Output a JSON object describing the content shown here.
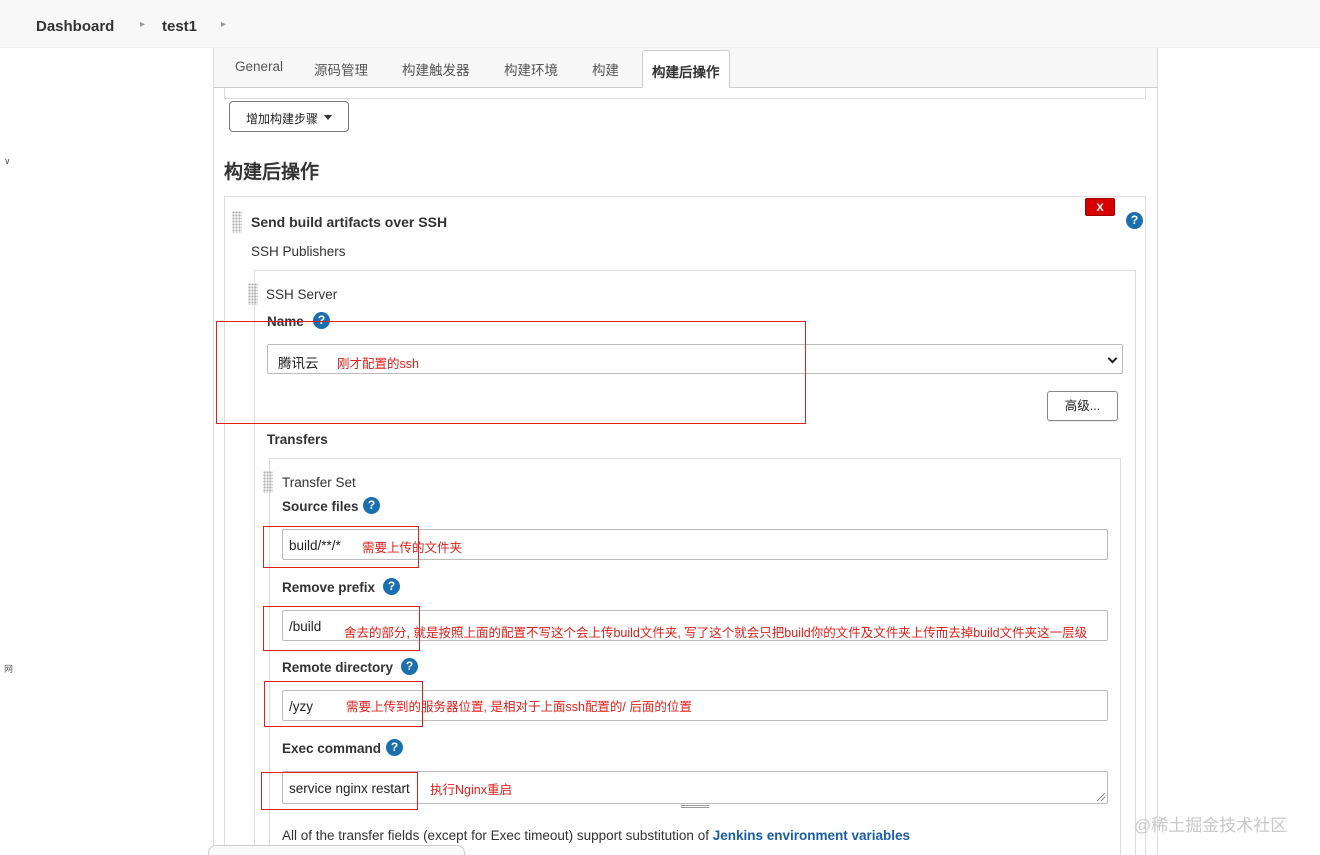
{
  "breadcrumb": {
    "items": [
      "Dashboard",
      "test1"
    ]
  },
  "left_edge": {
    "chars": [
      "∨",
      "网"
    ]
  },
  "tabs": [
    "General",
    "源码管理",
    "构建触发器",
    "构建环境",
    "构建",
    "构建后操作"
  ],
  "add_build_step": {
    "label": "增加构建步骤"
  },
  "section": {
    "heading": "构建后操作"
  },
  "post_build": {
    "title": "Send build artifacts over SSH",
    "delete_label": "X",
    "help": "?",
    "publishers_label": "SSH Publishers",
    "ssh_server": {
      "label": "SSH Server",
      "name_label": "Name",
      "name_value": "腾讯云",
      "name_note": "刚才配置的ssh",
      "advanced_label": "高级..."
    },
    "transfers_label": "Transfers",
    "transfer_set": {
      "label": "Transfer Set",
      "source_files": {
        "label": "Source files",
        "value": "build/**/*",
        "note": "需要上传的文件夹"
      },
      "remove_prefix": {
        "label": "Remove prefix",
        "value": "/build",
        "note": "舍去的部分, 就是按照上面的配置不写这个会上传build文件夹, 写了这个就会只把build你的文件及文件夹上传而去掉build文件夹这一层级"
      },
      "remote_directory": {
        "label": "Remote directory",
        "value": "/yzy",
        "note": "需要上传到的服务器位置, 是相对于上面ssh配置的/ 后面的位置"
      },
      "exec_command": {
        "label": "Exec command",
        "value": "service nginx restart",
        "note": "执行Nginx重启"
      }
    },
    "footer_note": {
      "text": "All of the transfer fields (except for Exec timeout) support substitution of ",
      "link": "Jenkins environment variables"
    }
  },
  "watermark": "@稀土掘金技术社区",
  "colors": {
    "annotation": "#e0201b",
    "link": "#1a5da6",
    "help_icon": "#1a6fae",
    "delete_button": "#d60000"
  }
}
